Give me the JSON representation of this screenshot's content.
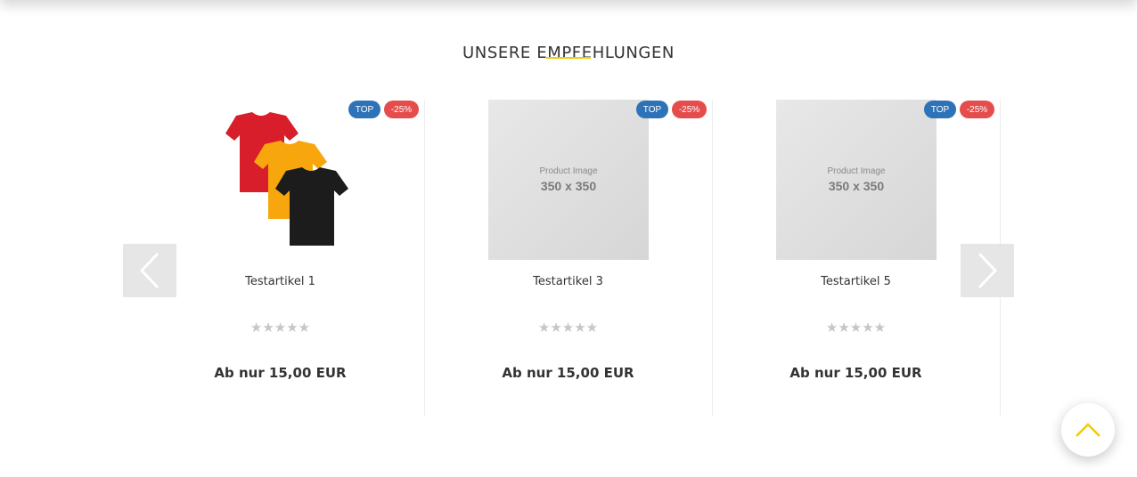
{
  "section": {
    "title": "UNSERE EMPFEHLUNGEN",
    "accent_color": "#f2cc00"
  },
  "carousel": {
    "prev_icon": "chevron-left-icon",
    "next_icon": "chevron-right-icon"
  },
  "products": [
    {
      "name": "Testartikel 1",
      "image": "tshirts-red-yellow-black",
      "badge_top": "TOP",
      "badge_discount": "-25%",
      "rating_stars": "★★★★★",
      "rating": 0,
      "price": "Ab nur 15,00 EUR"
    },
    {
      "name": "Testartikel 3",
      "image": "placeholder",
      "image_caption": "Product Image",
      "image_size": "350 x 350",
      "badge_top": "TOP",
      "badge_discount": "-25%",
      "rating_stars": "★★★★★",
      "rating": 0,
      "price": "Ab nur 15,00 EUR"
    },
    {
      "name": "Testartikel 5",
      "image": "placeholder",
      "image_caption": "Product Image",
      "image_size": "350 x 350",
      "badge_top": "TOP",
      "badge_discount": "-25%",
      "rating_stars": "★★★★★",
      "rating": 0,
      "price": "Ab nur 15,00 EUR"
    }
  ],
  "colors": {
    "badge_top": "#2e73b8",
    "badge_discount": "#e54d4d",
    "scroll_top_chevron": "#f2cc00"
  },
  "scroll_top": {
    "icon": "chevron-up-icon"
  }
}
